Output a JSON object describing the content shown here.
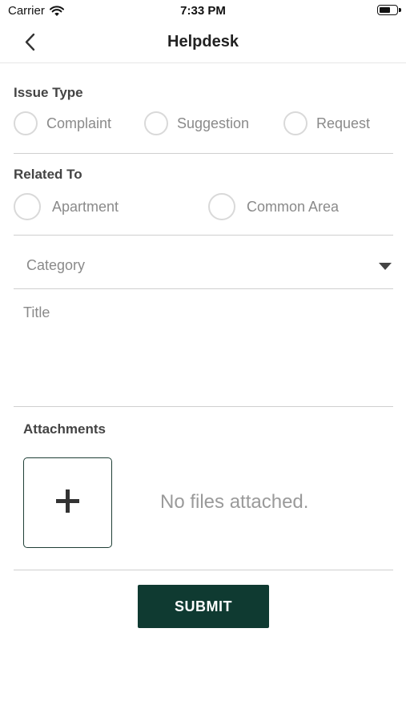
{
  "status_bar": {
    "carrier": "Carrier",
    "time": "7:33 PM",
    "wifi_icon": "wifi-icon",
    "battery_icon": "battery-icon"
  },
  "header": {
    "title": "Helpdesk",
    "back_icon": "chevron-left-icon"
  },
  "issue_type": {
    "label": "Issue Type",
    "options": [
      "Complaint",
      "Suggestion",
      "Request"
    ],
    "selected": null
  },
  "related_to": {
    "label": "Related To",
    "options": [
      "Apartment",
      "Common Area"
    ],
    "selected": null
  },
  "category": {
    "placeholder": "Category",
    "value": "",
    "caret_icon": "caret-down-icon"
  },
  "title_field": {
    "placeholder": "Title",
    "value": ""
  },
  "attachments": {
    "label": "Attachments",
    "add_icon": "plus-icon",
    "empty_text": "No files attached."
  },
  "submit": {
    "label": "SUBMIT"
  },
  "colors": {
    "accent": "#0f3a31",
    "radio_border": "#d9d9d9",
    "divider": "#cfcfcf",
    "muted_text": "#8a8a8a"
  }
}
